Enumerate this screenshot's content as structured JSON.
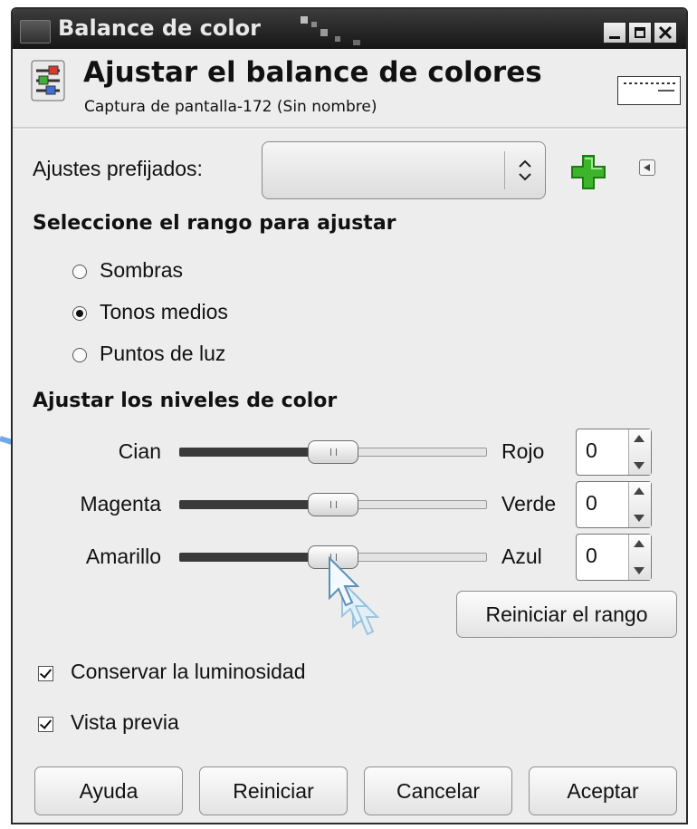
{
  "window": {
    "title": "Balance de color"
  },
  "header": {
    "title": "Ajustar el balance de colores",
    "subtitle": "Captura de pantalla-172 (Sin nombre)"
  },
  "presets": {
    "label": "Ajustes prefijados:",
    "selected_value": ""
  },
  "range": {
    "heading": "Seleccione el rango para ajustar",
    "options": [
      {
        "label": "Sombras",
        "selected": false
      },
      {
        "label": "Tonos medios",
        "selected": true
      },
      {
        "label": "Puntos de luz",
        "selected": false
      }
    ]
  },
  "levels": {
    "heading": "Ajustar los niveles de color",
    "sliders": [
      {
        "left": "Cian",
        "right": "Rojo",
        "value": "0"
      },
      {
        "left": "Magenta",
        "right": "Verde",
        "value": "0"
      },
      {
        "left": "Amarillo",
        "right": "Azul",
        "value": "0"
      }
    ],
    "reset_range_label": "Reiniciar el rango"
  },
  "options": {
    "preserve_luminosity": "Conservar la luminosidad",
    "preview": "Vista previa"
  },
  "buttons": {
    "help": "Ayuda",
    "reset": "Reiniciar",
    "cancel": "Cancelar",
    "ok": "Aceptar"
  },
  "icons": {
    "add_preset": "green-plus-icon",
    "preset_menu": "menu-arrow-icon",
    "dialog": "color-balance-icon"
  },
  "colors": {
    "add_icon": "#3db52b",
    "annotation_arrow": "#6fa9e6"
  }
}
